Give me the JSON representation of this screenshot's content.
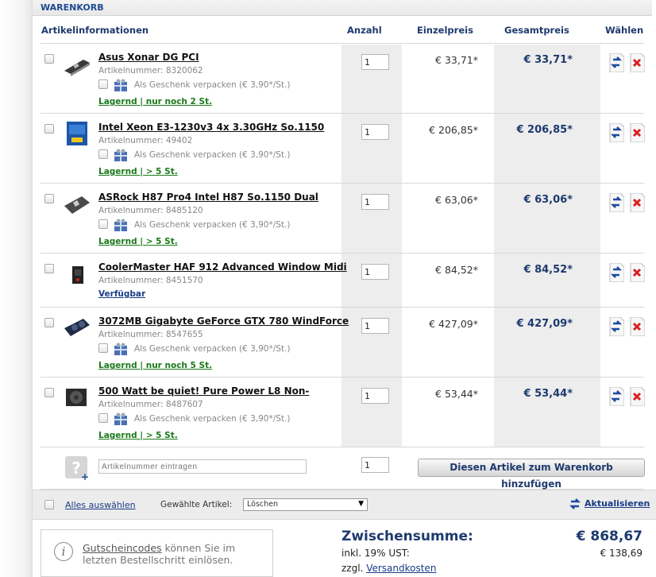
{
  "header": {
    "title": "WARENKORB"
  },
  "columns": {
    "info": "Artikelinformationen",
    "qty": "Anzahl",
    "unit": "Einzelpreis",
    "total": "Gesamtpreis",
    "choose": "Wählen"
  },
  "gift_label": "Als Geschenk verpacken (€ 3,90*/St.)",
  "items": [
    {
      "name": "Asus Xonar DG PCI",
      "artnr": "Artikelnummer: 8320062",
      "stock": "Lagernd | nur noch 2 St.",
      "qty": "1",
      "unit": "€ 33,71*",
      "total": "€ 33,71*"
    },
    {
      "name": "Intel Xeon E3-1230v3 4x 3.30GHz So.1150",
      "artnr": "Artikelnummer: 49402",
      "stock": "Lagernd | > 5 St.",
      "qty": "1",
      "unit": "€ 206,85*",
      "total": "€ 206,85*"
    },
    {
      "name": "ASRock H87 Pro4 Intel H87 So.1150 Dual",
      "artnr": "Artikelnummer: 8485120",
      "stock": "Lagernd | > 5 St.",
      "qty": "1",
      "unit": "€ 63,06*",
      "total": "€ 63,06*"
    },
    {
      "name": "CoolerMaster HAF 912 Advanced Window Midi",
      "artnr": "Artikelnummer: 8451570",
      "stock": "Verfügbar",
      "qty": "1",
      "unit": "€ 84,52*",
      "total": "€ 84,52*"
    },
    {
      "name": "3072MB Gigabyte GeForce GTX 780 WindForce",
      "artnr": "Artikelnummer: 8547655",
      "stock": "Lagernd | nur noch 5 St.",
      "qty": "1",
      "unit": "€ 427,09*",
      "total": "€ 427,09*"
    },
    {
      "name": "500 Watt be quiet! Pure Power L8 Non-",
      "artnr": "Artikelnummer: 8487607",
      "stock": "Lagernd | > 5 St.",
      "qty": "1",
      "unit": "€ 53,44*",
      "total": "€ 53,44*"
    }
  ],
  "add_row": {
    "placeholder": "Artikelnummer eintragen",
    "qty": "1",
    "button": "Diesen Artikel zum Warenkorb hinzufügen"
  },
  "bar": {
    "select_all": "Alles auswählen",
    "selected_label": "Gewählte Artikel:",
    "action": "Löschen",
    "update": "Aktualisieren"
  },
  "coupon": {
    "link": "Gutscheincodes",
    "text": " können Sie im letzten Bestellschritt einlösen."
  },
  "summary": {
    "subtotal_label": "Zwischensumme:",
    "subtotal": "€ 868,67",
    "vat_label": "inkl. 19% UST:",
    "vat": "€ 138,69",
    "shipping_prefix": "zzgl. ",
    "shipping_link": "Versandkosten"
  },
  "colors": {
    "accent": "#1e3a6e",
    "stock_green": "#1a7a1a",
    "link": "#1a3b86"
  }
}
